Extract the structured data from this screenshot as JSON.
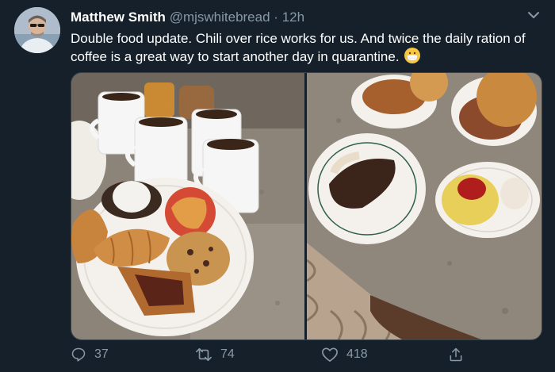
{
  "tweet": {
    "author_name": "Matthew Smith",
    "handle": "@mjswhitebread",
    "separator": "·",
    "time": "12h",
    "text": "Double food update.  Chili over rice works for us.  And twice the daily ration of coffee is a great way to start another day in quarantine.",
    "emoji": "face-with-medical-mask"
  },
  "icons": {
    "menu": "chevron-down-icon",
    "reply": "reply-icon",
    "retweet": "retweet-icon",
    "like": "heart-icon",
    "share": "share-icon"
  },
  "actions": {
    "replies": "37",
    "retweets": "74",
    "likes": "418"
  },
  "colors": {
    "background": "#15202b",
    "secondary_text": "#8899a6",
    "primary_text": "#ffffff",
    "border": "#38444d"
  }
}
